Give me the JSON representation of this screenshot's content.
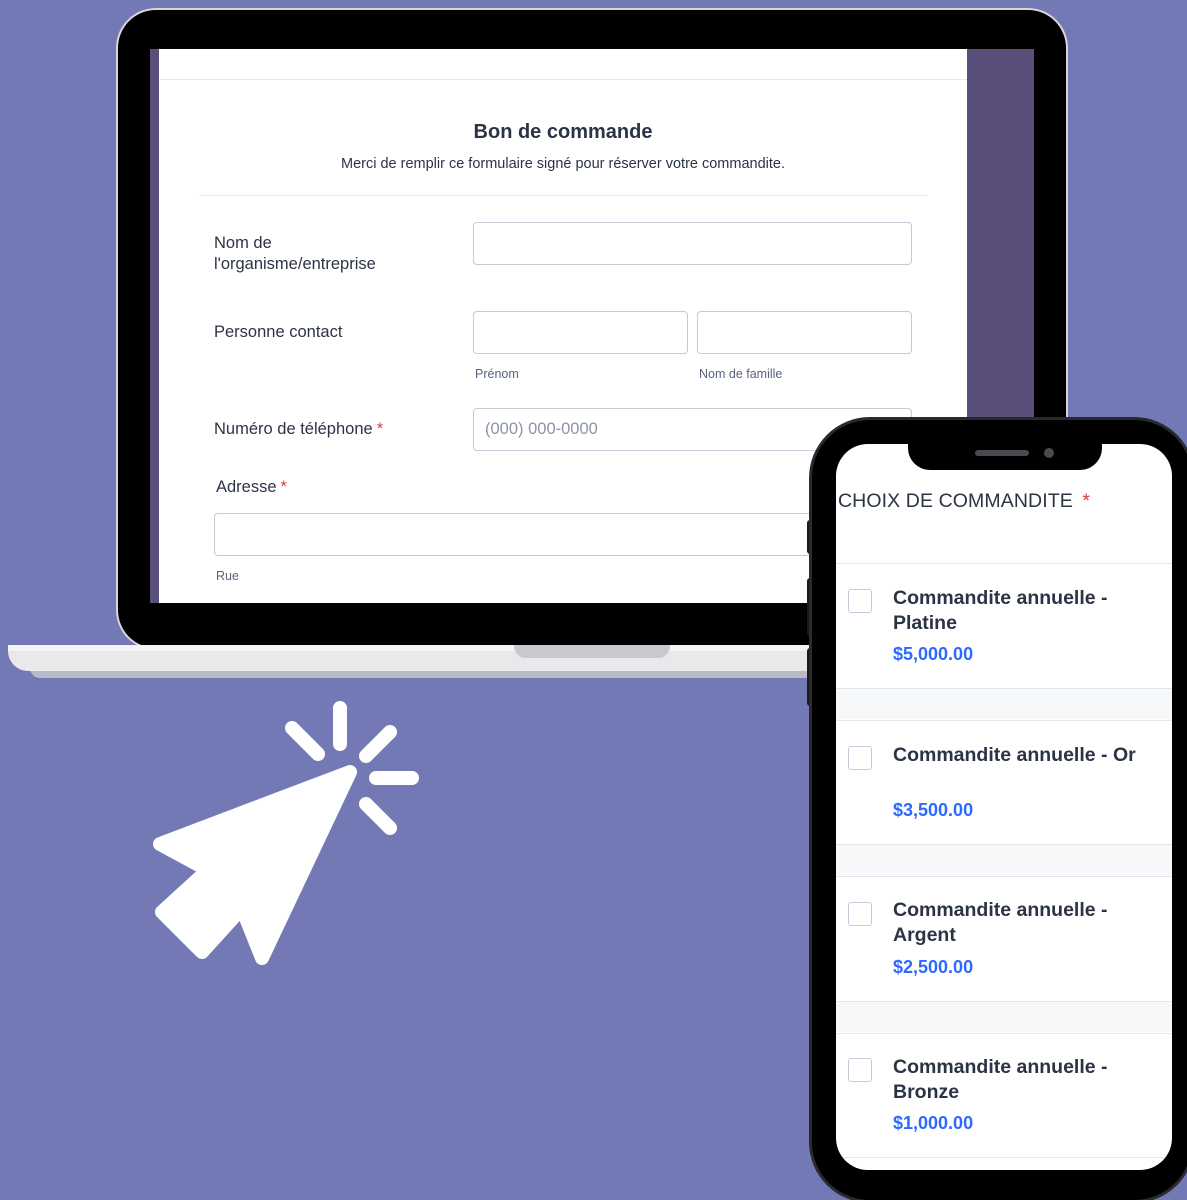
{
  "form": {
    "title": "Bon de commande",
    "subtitle": "Merci de remplir ce formulaire signé pour réserver votre commandite.",
    "org_label": "Nom de l'organisme/entreprise",
    "contact_label": "Personne contact",
    "first_name_sublabel": "Prénom",
    "last_name_sublabel": "Nom de famille",
    "phone_label": "Numéro de téléphone",
    "phone_required": "*",
    "phone_placeholder": "(000) 000-0000",
    "address_label": "Adresse",
    "address_required": "*",
    "street_sublabel": "Rue"
  },
  "mobile": {
    "header": "CHOIX DE COMMANDITE",
    "header_required": "*",
    "options": [
      {
        "title": "Commandite annuelle - Platine",
        "price": "$5,000.00"
      },
      {
        "title": "Commandite annuelle - Or",
        "price": "$3,500.00"
      },
      {
        "title": "Commandite annuelle - Argent",
        "price": "$2,500.00"
      },
      {
        "title": "Commandite annuelle - Bronze",
        "price": "$1,000.00"
      }
    ]
  },
  "colors": {
    "background": "#7279b4",
    "price": "#2e69ff",
    "required": "#e03a3a",
    "text": "#2c3345"
  }
}
